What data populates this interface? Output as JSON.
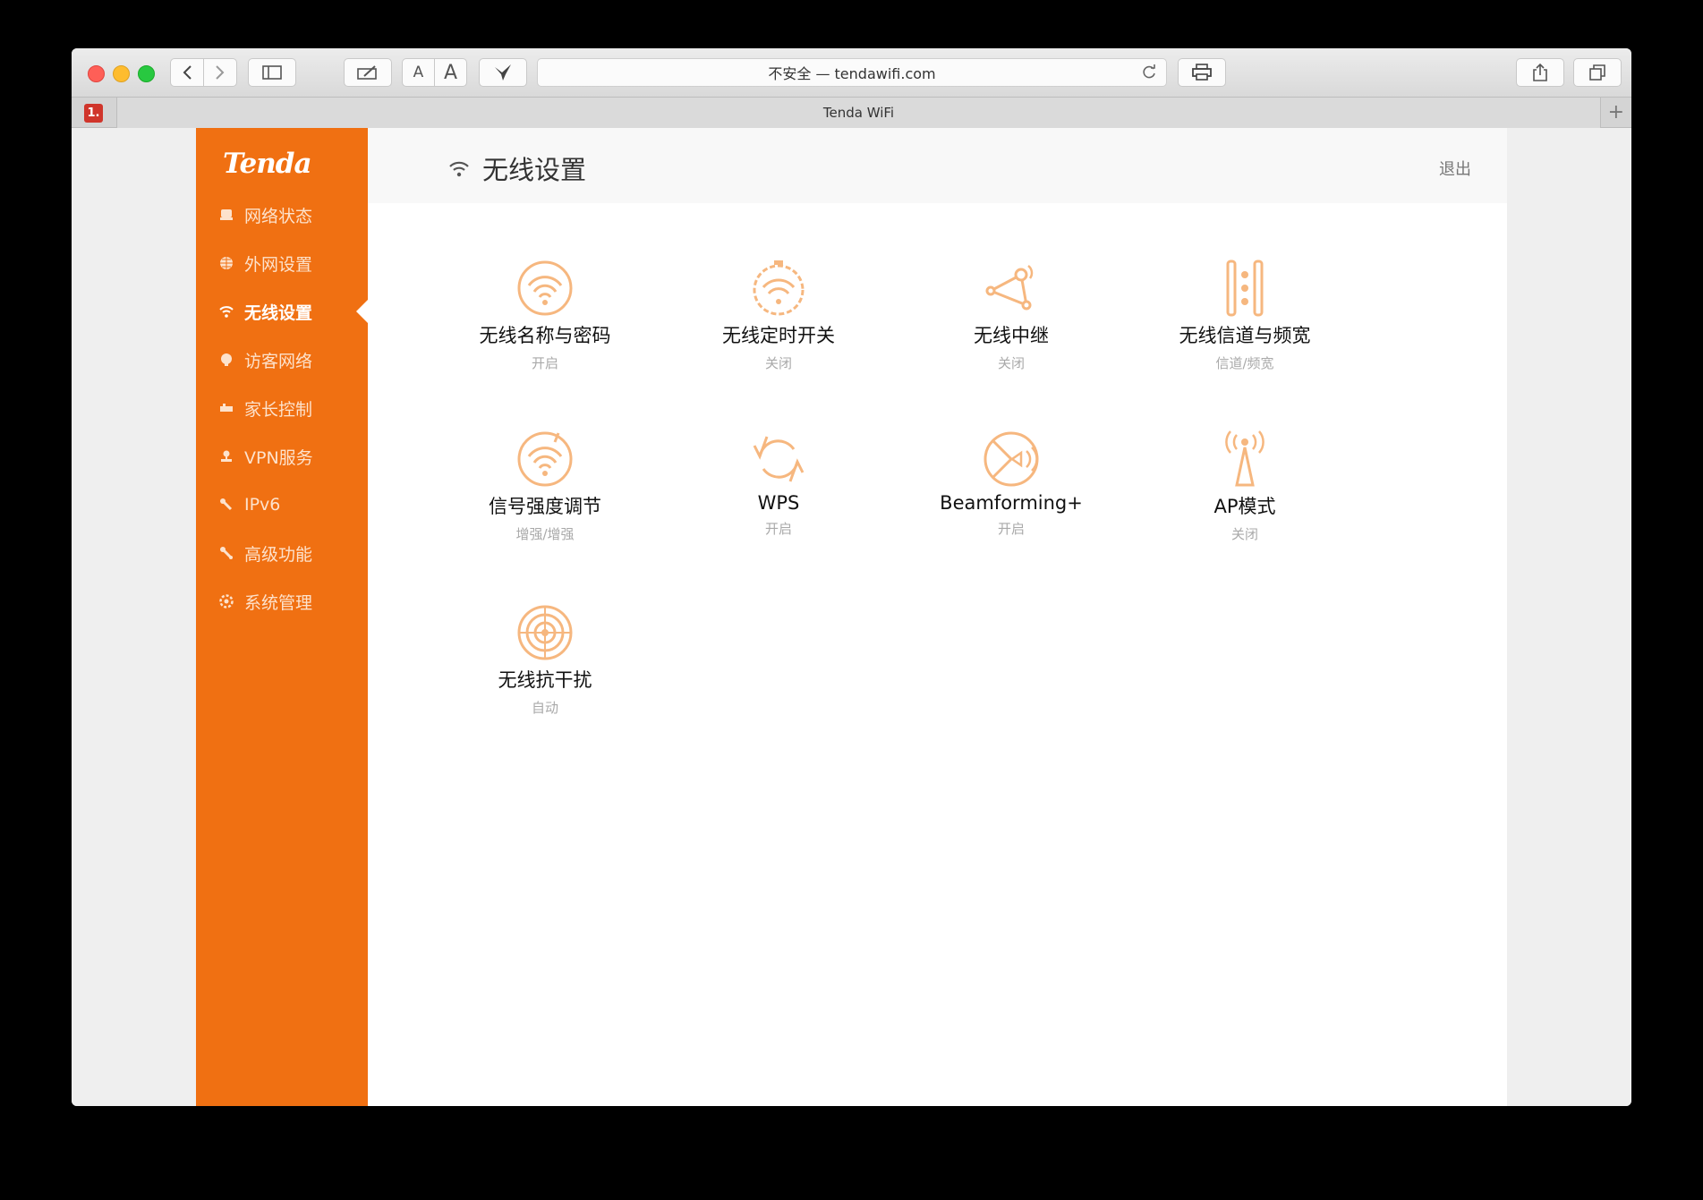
{
  "browser": {
    "address": "不安全 — tendawifi.com",
    "tab_title": "Tenda WiFi",
    "pinned_tab": "1.",
    "font_small": "A",
    "font_large": "A",
    "new_tab": "+"
  },
  "sidebar": {
    "logo": "Tenda",
    "items": [
      {
        "label": "网络状态"
      },
      {
        "label": "外网设置"
      },
      {
        "label": "无线设置"
      },
      {
        "label": "访客网络"
      },
      {
        "label": "家长控制"
      },
      {
        "label": "VPN服务"
      },
      {
        "label": "IPv6"
      },
      {
        "label": "高级功能"
      },
      {
        "label": "系统管理"
      }
    ]
  },
  "header": {
    "title": "无线设置",
    "logout": "退出"
  },
  "tiles": [
    {
      "label": "无线名称与密码",
      "status": "开启"
    },
    {
      "label": "无线定时开关",
      "status": "关闭"
    },
    {
      "label": "无线中继",
      "status": "关闭"
    },
    {
      "label": "无线信道与频宽",
      "status": "信道/频宽"
    },
    {
      "label": "信号强度调节",
      "status": "增强/增强"
    },
    {
      "label": "WPS",
      "status": "开启"
    },
    {
      "label": "Beamforming+",
      "status": "开启"
    },
    {
      "label": "AP模式",
      "status": "关闭"
    },
    {
      "label": "无线抗干扰",
      "status": "自动"
    }
  ],
  "colors": {
    "brand": "#f07012",
    "icon": "#f6b77f"
  }
}
